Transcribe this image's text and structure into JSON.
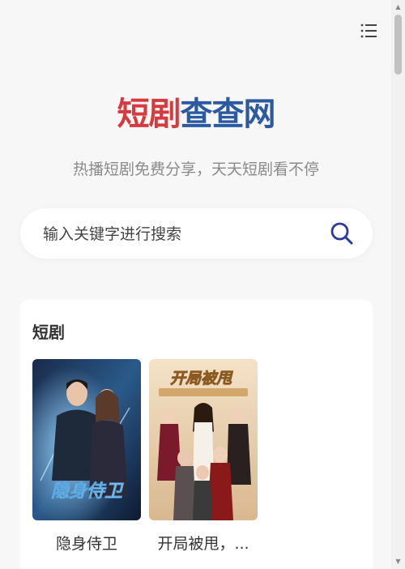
{
  "header": {
    "menu_icon": "menu-list-icon"
  },
  "logo": {
    "part1": "短剧",
    "part2": "查查网",
    "colors": {
      "red": "#d53a3f",
      "blue": "#2c5aa0"
    }
  },
  "slogan": "热播短剧免费分享，天天短剧看不停",
  "search": {
    "placeholder": "输入关键字进行搜索",
    "icon": "search-icon",
    "icon_color": "#2b3a9b"
  },
  "section": {
    "title": "短剧",
    "items": [
      {
        "title": "隐身侍卫",
        "poster_text": "隐身侍卫"
      },
      {
        "title": "开局被甩，...",
        "poster_text": "开局被甩"
      }
    ]
  }
}
